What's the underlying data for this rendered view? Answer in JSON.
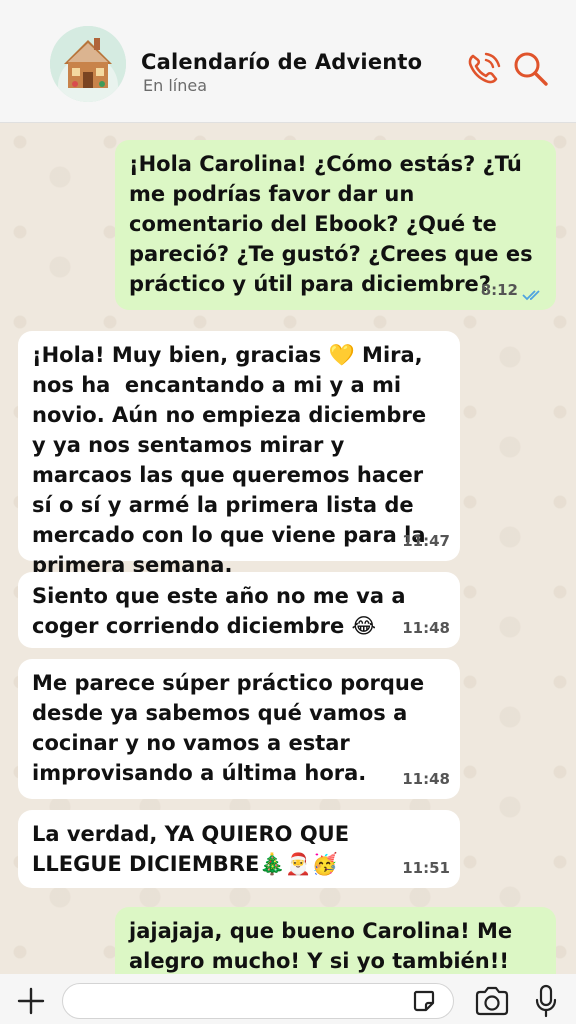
{
  "header": {
    "contact_name": "Calendarío de Adviento",
    "status": "En línea"
  },
  "messages": [
    {
      "direction": "out",
      "text": "¡Hola Carolina! ¿Cómo estás? ¿Tú me podrías favor dar un comentario del Ebook? ¿Qué te pareció? ¿Te gustó? ¿Crees que es práctico y útil para diciembre?",
      "time": "8:12",
      "status": "read"
    },
    {
      "direction": "in",
      "text": "¡Hola! Muy bien, gracias 💛 Mira, nos ha  encantando a mi y a mi novio. Aún no empieza diciembre y ya nos sentamos mirar y marcaos las que queremos hacer sí o sí y armé la primera lista de mercado con lo que viene para la primera semana.",
      "time": "11:47"
    },
    {
      "direction": "in",
      "text": "Siento que este año no me va a coger corriendo diciembre 😂",
      "time": "11:48"
    },
    {
      "direction": "in",
      "text": "Me parece súper práctico porque desde ya sabemos qué vamos a cocinar y no vamos a estar improvisando a última hora.",
      "time": "11:48"
    },
    {
      "direction": "in",
      "text": "La verdad, YA QUIERO QUE LLEGUE DICIEMBRE🎄🎅🥳",
      "time": "11:51"
    },
    {
      "direction": "out",
      "text": "jajajaja, que bueno Carolina! Me alegro mucho! Y si yo también!! va a",
      "time": ""
    }
  ],
  "composer": {
    "placeholder": ""
  },
  "colors": {
    "accent": "#e0542c",
    "outgoing_bubble": "#dcf7c5",
    "incoming_bubble": "#ffffff",
    "read_ticks": "#4fa3e0"
  },
  "icons": [
    "phone-icon",
    "search-icon",
    "plus-icon",
    "sticker-icon",
    "camera-icon",
    "microphone-icon",
    "double-check-icon"
  ]
}
